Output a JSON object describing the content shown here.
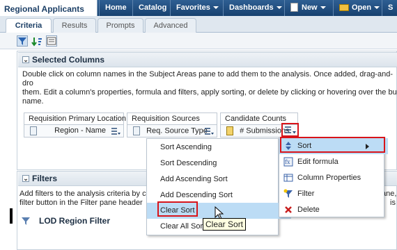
{
  "app_title": "Regional Applicants",
  "nav": [
    {
      "label": "Home",
      "dropdown": false
    },
    {
      "label": "Catalog",
      "dropdown": false
    },
    {
      "label": "Favorites",
      "dropdown": true
    },
    {
      "label": "Dashboards",
      "dropdown": true
    },
    {
      "label": "New",
      "dropdown": true
    },
    {
      "label": "Open",
      "dropdown": true
    },
    {
      "label": "S",
      "dropdown": false
    }
  ],
  "tabs": [
    "Criteria",
    "Results",
    "Prompts",
    "Advanced"
  ],
  "selected_columns": {
    "header": "Selected Columns",
    "help": "Double click on column names in the Subject Areas pane to add them to the analysis. Once added, drag-and-drop them. Edit a column's properties, formula and filters, apply sorting, or delete by clicking or hovering over the button name.",
    "help_line1": "Double click on column names in the Subject Areas pane to add them to the analysis. Once added, drag-and-dro",
    "help_line2": "them. Edit a column's properties, formula and filters, apply sorting, or delete by clicking or hovering over the bu",
    "help_line3": "name.",
    "columns": [
      {
        "folder": "Requisition Primary Location",
        "name": "Region - Name"
      },
      {
        "folder": "Requisition Sources",
        "name": "Req. Source Type"
      },
      {
        "folder": "Candidate Counts",
        "name": "# Submissions"
      }
    ]
  },
  "filters": {
    "header": "Filters",
    "help_line1": "Add filters to the analysis criteria by c",
    "help_line1_end": "ane,",
    "help_line2": "filter button in the Filter pane header",
    "help_line2_end": "is",
    "filter_name": "LOD Region Filter"
  },
  "column_menu": [
    {
      "label": "Sort",
      "submenu": true,
      "highlighted": true
    },
    {
      "label": "Edit formula"
    },
    {
      "label": "Column Properties"
    },
    {
      "label": "Filter"
    },
    {
      "label": "Delete"
    }
  ],
  "sort_submenu": [
    {
      "label": "Sort Ascending"
    },
    {
      "label": "Sort Descending"
    },
    {
      "label": "Add Ascending Sort"
    },
    {
      "label": "Add Descending Sort"
    },
    {
      "label": "Clear Sort",
      "hovered": true
    },
    {
      "label": "Clear All Sort"
    }
  ],
  "tooltip": "Clear Sort",
  "colors": {
    "nav_bg": "#17416f",
    "highlight": "#bcdcf5",
    "callout": "#d8141a"
  }
}
